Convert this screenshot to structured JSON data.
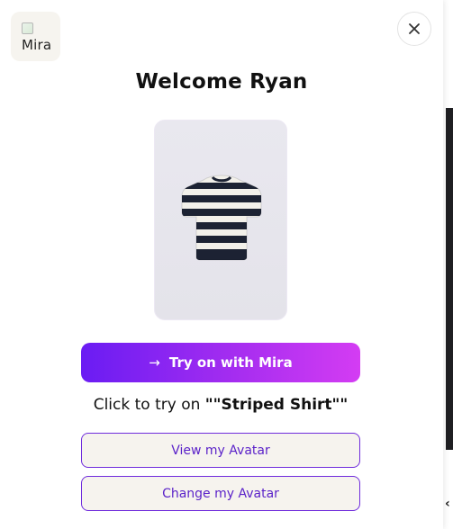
{
  "logo": {
    "alt_text": "Mira",
    "icon": "broken-image-icon"
  },
  "close": {
    "icon": "close-icon"
  },
  "header": {
    "title": "Welcome Ryan"
  },
  "product": {
    "image": "striped-shirt-image",
    "name": "Striped Shirt",
    "stripe_color": "#1c2233",
    "base_color": "#f2f0ea"
  },
  "actions": {
    "try_on_label": "Try on with Mira",
    "try_on_icon": "arrow-right-icon",
    "prompt_prefix": "Click to try on ",
    "prompt_item": "\"\"Striped Shirt\"\"",
    "view_avatar_label": "View my Avatar",
    "change_avatar_label": "Change my Avatar"
  },
  "colors": {
    "accent_start": "#6a1cf3",
    "accent_end": "#d43cf3",
    "outline": "#6f2bdc",
    "button_bg": "#f6f3ee"
  }
}
